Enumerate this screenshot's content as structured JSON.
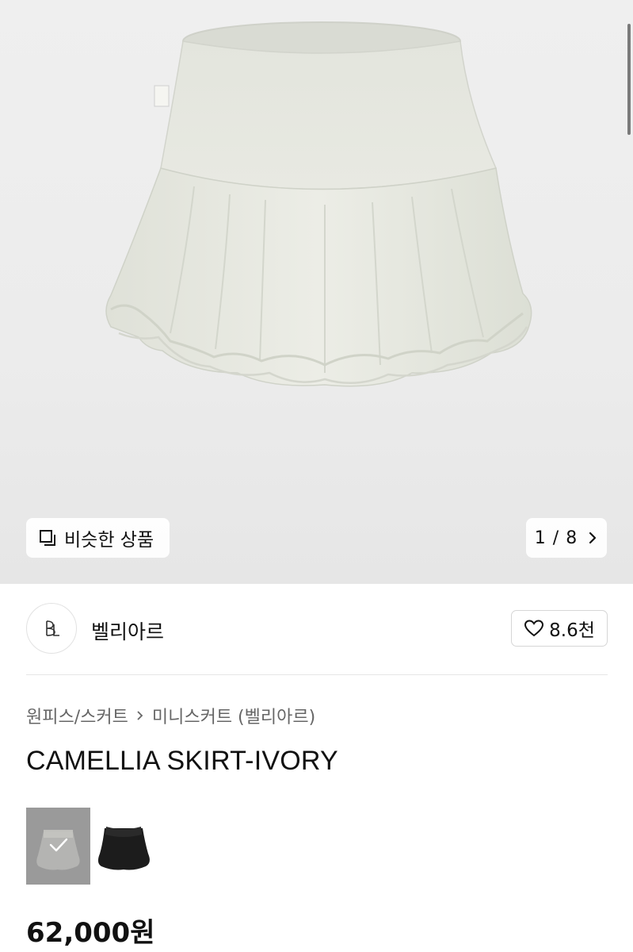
{
  "gallery": {
    "similar_label": "비슷한 상품",
    "counter": "1 / 8"
  },
  "seller": {
    "name": "벨리아르",
    "likes": "8.6천"
  },
  "breadcrumb": {
    "category": "원피스/스커트",
    "subcategory": "미니스커트 (벨리아르)"
  },
  "product": {
    "title": "CAMELLIA SKIRT-IVORY",
    "price": "62,000원"
  },
  "swatches": [
    {
      "name": "ivory",
      "selected": true
    },
    {
      "name": "black",
      "selected": false
    }
  ],
  "colors": {
    "skirt_ivory": "#e9eae3",
    "hero_bg": "#ececec",
    "swatch_selected_overlay": "#9a9a9a"
  }
}
